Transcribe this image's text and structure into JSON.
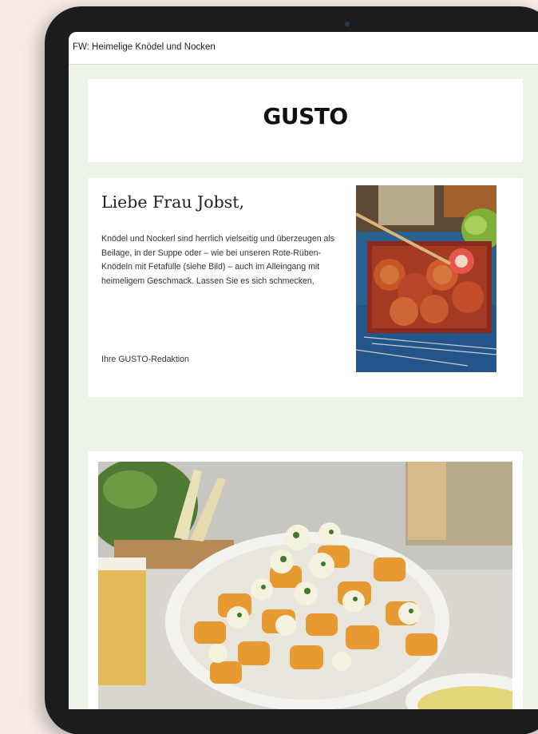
{
  "email": {
    "subject": "FW: Heimelige Knödel und Nocken"
  },
  "newsletter": {
    "brand": "GUSTO",
    "greeting": "Liebe Frau Jobst,",
    "body": "Knödel und Nockerl sind herrlich vielseitig und überzeugen als Beilage, in der Suppe oder – wie bei unseren Rote-Rüben-Knödeln mit Fetafülle (siehe Bild) – auch im Alleingang mit heimeligem Geschmack. Lassen Sie es sich schmecken,",
    "signature": "Ihre GUSTO-Redaktion"
  },
  "colors": {
    "page_background": "#f7ebe7",
    "device_frame": "#1c1c1e",
    "email_background": "#eef3ea",
    "card_background": "#ffffff",
    "text_dark": "#222222"
  },
  "images": {
    "intro_photo": "beetroot-dumplings-photo",
    "recipe_photo": "pumpkin-gnocchi-photo"
  }
}
